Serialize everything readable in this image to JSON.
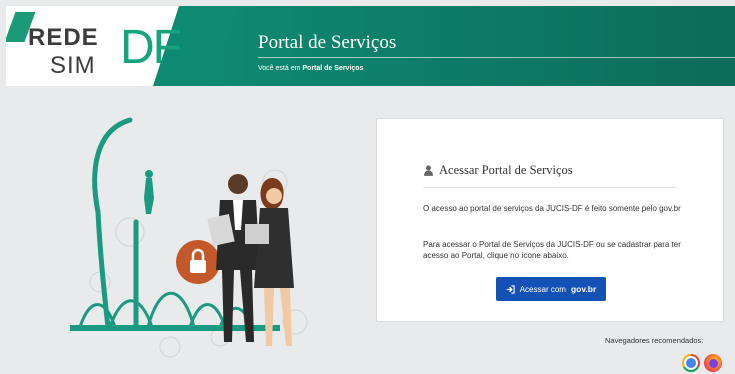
{
  "header": {
    "logo_rede": "REDE",
    "logo_sim": "SIM",
    "logo_df": "DF",
    "title": "Portal de Serviços",
    "breadcrumb_prefix": "Você está em",
    "breadcrumb_current": "Portal de Serviços"
  },
  "card": {
    "title": "Acessar Portal de Serviços",
    "paragraph_1": "O acesso ao portal de serviços da JUCIS-DF é feito somente pelo gov.br",
    "paragraph_2": "Para acessar o Portal de Serviços da JUCIS-DF ou se cadastrar para ter acesso ao Portal, clique no ícone abaixo.",
    "button_label": "Acessar com",
    "button_brand": "gov.br"
  },
  "footer": {
    "browsers_label": "Navegadores recomendados:",
    "browsers": [
      "chrome-icon",
      "firefox-icon"
    ]
  },
  "colors": {
    "teal": "#0f8a72",
    "logo_green": "#17a37b",
    "button_blue": "#1351b4"
  }
}
